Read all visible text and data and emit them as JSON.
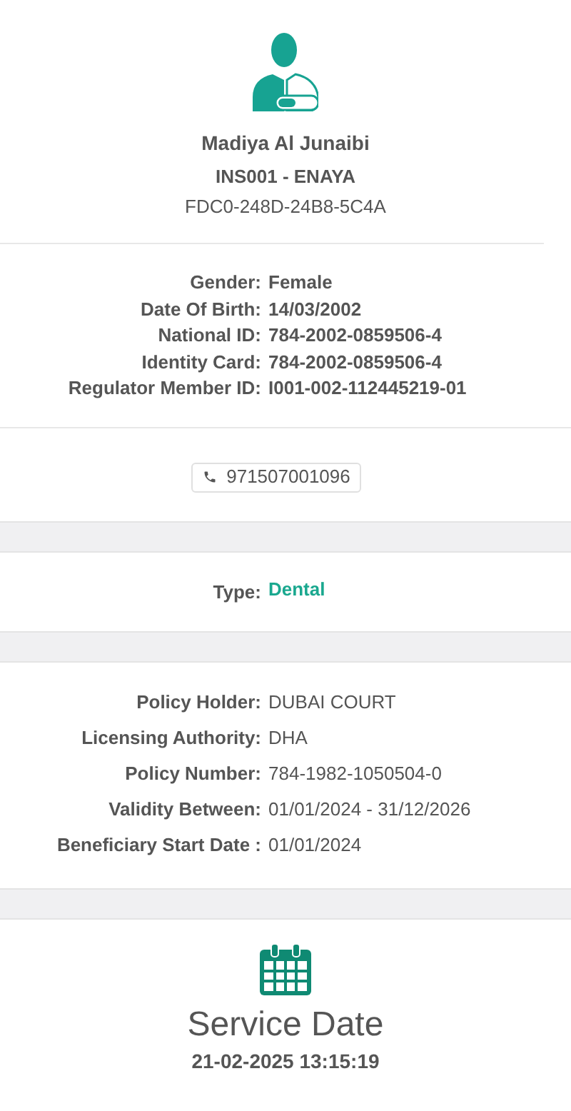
{
  "profile": {
    "name": "Madiya Al Junaibi",
    "insurer": "INS001 - ENAYA",
    "code": "FDC0-248D-24B8-5C4A"
  },
  "details": [
    {
      "label": "Gender:",
      "value": "Female"
    },
    {
      "label": "Date Of Birth:",
      "value": "14/03/2002"
    },
    {
      "label": "National ID:",
      "value": "784-2002-0859506-4"
    },
    {
      "label": "Identity Card:",
      "value": "784-2002-0859506-4"
    },
    {
      "label": "Regulator Member ID:",
      "value": "I001-002-112445219-01"
    }
  ],
  "phone": "971507001096",
  "type": {
    "label": "Type:",
    "value": "Dental"
  },
  "policy": [
    {
      "label": "Policy Holder:",
      "value": "DUBAI COURT"
    },
    {
      "label": "Licensing Authority:",
      "value": "DHA"
    },
    {
      "label": "Policy Number:",
      "value": "784-1982-1050504-0"
    },
    {
      "label": "Validity Between:",
      "value": "01/01/2024 - 31/12/2026"
    },
    {
      "label": "Beneficiary Start Date :",
      "value": "01/01/2024"
    }
  ],
  "service": {
    "title": "Service Date",
    "datetime": "21-02-2025 13:15:19"
  }
}
